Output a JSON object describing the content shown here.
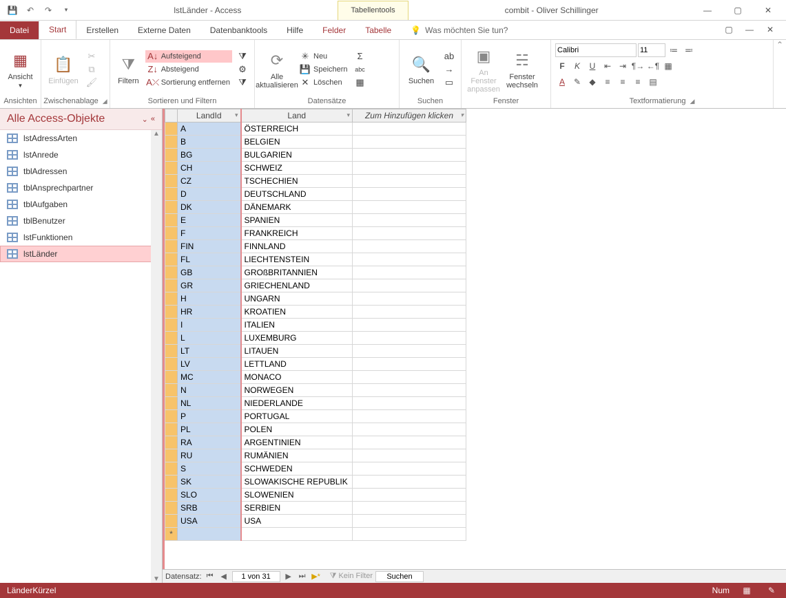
{
  "titlebar": {
    "app_title": "lstLänder  -  Access",
    "tabletools_label": "Tabellentools",
    "right_title": "combit - Oliver Schillinger"
  },
  "tabs": {
    "datei": "Datei",
    "start": "Start",
    "erstellen": "Erstellen",
    "extern": "Externe Daten",
    "dbtools": "Datenbanktools",
    "hilfe": "Hilfe",
    "felder": "Felder",
    "tabelle": "Tabelle",
    "tellme": "Was möchten Sie tun?"
  },
  "ribbon": {
    "views": {
      "label": "Ansichten",
      "ansicht": "Ansicht"
    },
    "clipboard": {
      "label": "Zwischenablage",
      "einfuegen": "Einfügen"
    },
    "sortfilter": {
      "label": "Sortieren und Filtern",
      "filtern": "Filtern",
      "aufsteigend": "Aufsteigend",
      "absteigend": "Absteigend",
      "entfernen": "Sortierung entfernen"
    },
    "records": {
      "label": "Datensätze",
      "alle_aktualisieren": "Alle\naktualisieren",
      "neu": "Neu",
      "speichern": "Speichern",
      "loeschen": "Löschen"
    },
    "find": {
      "label": "Suchen",
      "suchen": "Suchen"
    },
    "window": {
      "label": "Fenster",
      "an_fenster": "An Fenster\nanpassen",
      "wechseln": "Fenster\nwechseln"
    },
    "textformat": {
      "label": "Textformatierung",
      "font_name": "Calibri",
      "font_size": "11"
    }
  },
  "navpane": {
    "header": "Alle Access-Objekte",
    "items": [
      {
        "label": "lstAdressArten"
      },
      {
        "label": "lstAnrede"
      },
      {
        "label": "tblAdressen"
      },
      {
        "label": "tblAnsprechpartner"
      },
      {
        "label": "tblAufgaben"
      },
      {
        "label": "tblBenutzer"
      },
      {
        "label": "lstFunktionen"
      },
      {
        "label": "lstLänder"
      }
    ],
    "active_index": 7
  },
  "datasheet": {
    "columns": {
      "landid": "LandId",
      "land": "Land",
      "add": "Zum Hinzufügen klicken"
    },
    "rows": [
      {
        "landid": "A",
        "land": "ÖSTERREICH"
      },
      {
        "landid": "B",
        "land": "BELGIEN"
      },
      {
        "landid": "BG",
        "land": "BULGARIEN"
      },
      {
        "landid": "CH",
        "land": "SCHWEIZ"
      },
      {
        "landid": "CZ",
        "land": "TSCHECHIEN"
      },
      {
        "landid": "D",
        "land": "DEUTSCHLAND"
      },
      {
        "landid": "DK",
        "land": "DÄNEMARK"
      },
      {
        "landid": "E",
        "land": "SPANIEN"
      },
      {
        "landid": "F",
        "land": "FRANKREICH"
      },
      {
        "landid": "FIN",
        "land": "FINNLAND"
      },
      {
        "landid": "FL",
        "land": "LIECHTENSTEIN"
      },
      {
        "landid": "GB",
        "land": "GROßBRITANNIEN"
      },
      {
        "landid": "GR",
        "land": "GRIECHENLAND"
      },
      {
        "landid": "H",
        "land": "UNGARN"
      },
      {
        "landid": "HR",
        "land": "KROATIEN"
      },
      {
        "landid": "I",
        "land": "ITALIEN"
      },
      {
        "landid": "L",
        "land": "LUXEMBURG"
      },
      {
        "landid": "LT",
        "land": "LITAUEN"
      },
      {
        "landid": "LV",
        "land": "LETTLAND"
      },
      {
        "landid": "MC",
        "land": "MONACO"
      },
      {
        "landid": "N",
        "land": "NORWEGEN"
      },
      {
        "landid": "NL",
        "land": "NIEDERLANDE"
      },
      {
        "landid": "P",
        "land": "PORTUGAL"
      },
      {
        "landid": "PL",
        "land": "POLEN"
      },
      {
        "landid": "RA",
        "land": "ARGENTINIEN"
      },
      {
        "landid": "RU",
        "land": "RUMÄNIEN"
      },
      {
        "landid": "S",
        "land": "SCHWEDEN"
      },
      {
        "landid": "SK",
        "land": "SLOWAKISCHE REPUBLIK"
      },
      {
        "landid": "SLO",
        "land": "SLOWENIEN"
      },
      {
        "landid": "SRB",
        "land": "SERBIEN"
      },
      {
        "landid": "USA",
        "land": "USA"
      }
    ]
  },
  "recordnav": {
    "label": "Datensatz:",
    "position": "1 von 31",
    "kein_filter": "Kein Filter",
    "suchen": "Suchen"
  },
  "statusbar": {
    "left": "LänderKürzel",
    "num": "Num"
  }
}
